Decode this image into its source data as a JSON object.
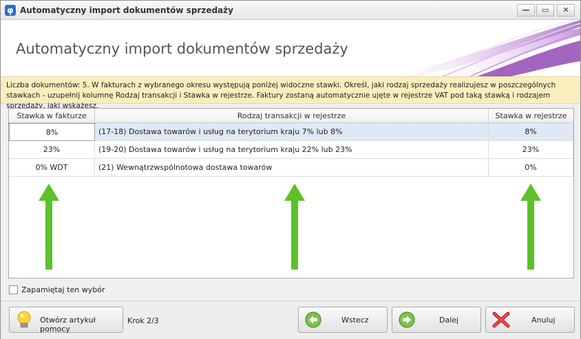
{
  "window": {
    "title": "Automatyczny import dokumentów sprzedaży",
    "icon": "phi-app-icon",
    "controls": {
      "minimize": "—",
      "maximize": "▭",
      "close": "✕"
    }
  },
  "header": {
    "title": "Automatyczny import dokumentów sprzedaży"
  },
  "info": {
    "text": "Liczba dokumentów: 5. W fakturach z wybranego okresu występują poniżej widoczne stawki. Określ, jaki rodzaj sprzedaży realizujesz w poszczególnych stawkach - uzupełnij kolumnę Rodzaj transakcji i Stawka w rejestrze. Faktury zostaną automatycznie ujęte w rejestrze VAT pod taką stawką i rodzajem sprzedaży, jaki wskażesz."
  },
  "grid": {
    "columns": [
      "Stawka w fakturze",
      "Rodzaj transakcji w rejestrze",
      "Stawka w rejestrze"
    ],
    "rows": [
      {
        "stawka_faktura": "8%",
        "rodzaj": "(17-18) Dostawa towarów i usług na terytorium kraju 7% lub 8%",
        "stawka_rejestr": "8%"
      },
      {
        "stawka_faktura": "23%",
        "rodzaj": "(19-20) Dostawa towarów i usług na terytorium kraju 22% lub 23%",
        "stawka_rejestr": "23%"
      },
      {
        "stawka_faktura": "0% WDT",
        "rodzaj": "(21) Wewnątrzwspólnotowa dostawa towarów",
        "stawka_rejestr": "0%"
      }
    ],
    "selected_row_color": "#dfe8f6",
    "annotation_arrow_color": "#5cc12a"
  },
  "remember": {
    "label": "Zapamiętaj ten wybór",
    "checked": false
  },
  "footer": {
    "help_label": "Otwórz artykuł pomocy",
    "help_icon": "lightbulb-icon",
    "step": "Krok 2/3",
    "back_label": "Wstecz",
    "back_icon": "arrow-left-icon",
    "next_label": "Dalej",
    "next_icon": "arrow-right-icon",
    "cancel_label": "Anuluj",
    "cancel_icon": "red-x-icon"
  }
}
